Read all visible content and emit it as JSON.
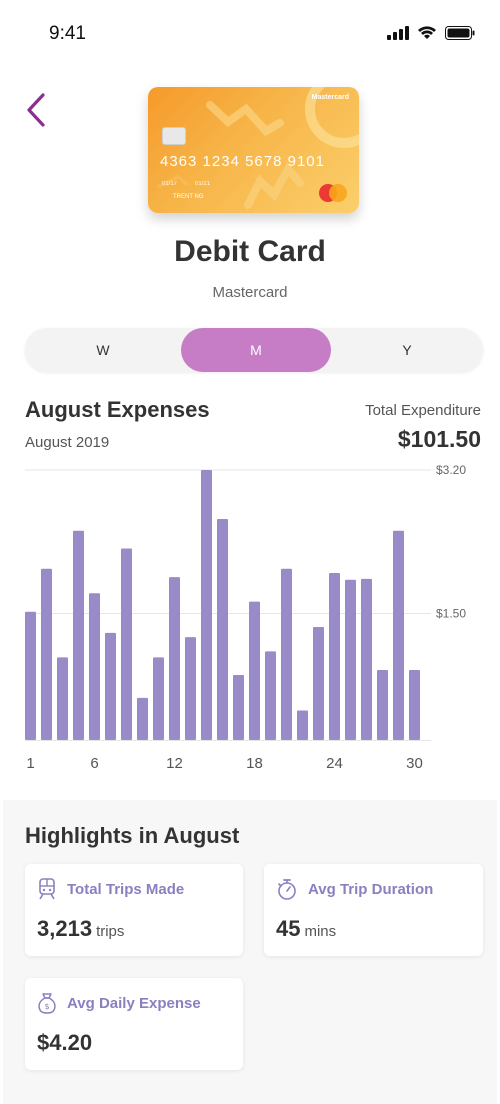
{
  "status_bar": {
    "time": "9:41"
  },
  "card": {
    "brand": "Mastercard",
    "number": "4363 1234 5678 9101",
    "valid_from": "01/17",
    "valid_thru": "01/21",
    "holder": "TRENT NG"
  },
  "header": {
    "title": "Debit Card",
    "subtitle": "Mastercard"
  },
  "period_tabs": [
    {
      "label": "W",
      "active": false
    },
    {
      "label": "M",
      "active": true
    },
    {
      "label": "Y",
      "active": false
    }
  ],
  "expenses": {
    "title": "August Expenses",
    "period": "August 2019",
    "total_label": "Total Expenditure",
    "total_value": "$101.50"
  },
  "chart_data": {
    "type": "bar",
    "x": [
      1,
      2,
      3,
      4,
      5,
      6,
      7,
      8,
      9,
      10,
      11,
      12,
      13,
      14,
      15,
      16,
      17,
      18,
      19,
      20,
      21,
      22,
      23,
      24,
      25,
      26,
      27,
      28,
      29,
      30,
      31
    ],
    "values": [
      1.52,
      2.03,
      0.98,
      2.48,
      1.74,
      1.27,
      2.27,
      0.5,
      0.98,
      1.93,
      1.22,
      3.2,
      2.62,
      0.77,
      1.64,
      1.05,
      2.03,
      0.35,
      1.34,
      1.98,
      1.9,
      1.91,
      0.83,
      2.48,
      0.83
    ],
    "xticks": [
      "1",
      "6",
      "12",
      "18",
      "24",
      "30"
    ],
    "yticks": [
      "$3.20",
      "$1.50"
    ],
    "ylim": [
      0,
      3.2
    ],
    "bar_color": "#988bc7"
  },
  "highlights": {
    "title": "Highlights in August",
    "items": [
      {
        "icon": "train-icon",
        "label": "Total Trips Made",
        "value": "3,213",
        "unit": "trips"
      },
      {
        "icon": "stopwatch-icon",
        "label": "Avg Trip Duration",
        "value": "45",
        "unit": "mins"
      },
      {
        "icon": "money-bag-icon",
        "label": "Avg Daily Expense",
        "value": "$4.20",
        "unit": ""
      }
    ]
  },
  "colors": {
    "accent": "#c77dc6",
    "back_arrow": "#8b2f8f",
    "bar": "#988bc7",
    "highlight_label": "#8a80c0"
  }
}
